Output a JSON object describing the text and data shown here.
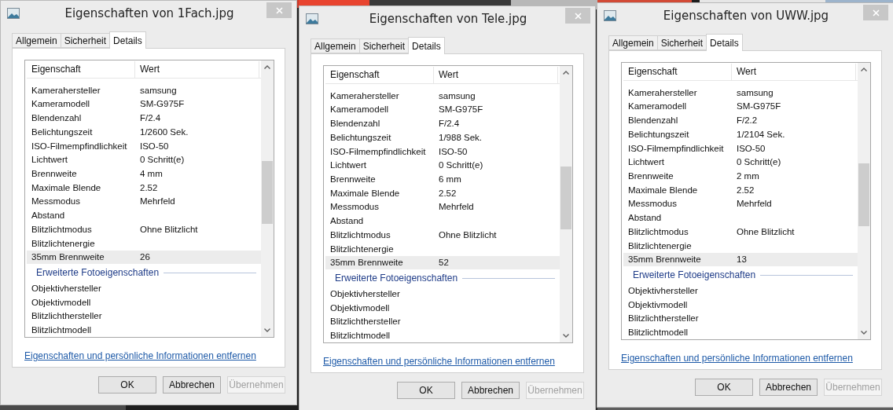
{
  "windows": [
    {
      "title": "Eigenschaften von 1Fach.jpg",
      "tabs": [
        {
          "label": "Allgemein",
          "selected": false
        },
        {
          "label": "Sicherheit",
          "selected": false
        },
        {
          "label": "Details",
          "selected": true
        }
      ],
      "columns": [
        "Eigenschaft",
        "Wert"
      ],
      "rows": [
        {
          "kind": "row",
          "property": "Kamerahersteller",
          "value": "samsung",
          "selected": false
        },
        {
          "kind": "row",
          "property": "Kameramodell",
          "value": "SM-G975F",
          "selected": false
        },
        {
          "kind": "row",
          "property": "Blendenzahl",
          "value": "F/2.4",
          "selected": false
        },
        {
          "kind": "row",
          "property": "Belichtungszeit",
          "value": "1/2600 Sek.",
          "selected": false
        },
        {
          "kind": "row",
          "property": "ISO-Filmempfindlichkeit",
          "value": "ISO-50",
          "selected": false
        },
        {
          "kind": "row",
          "property": "Lichtwert",
          "value": "0 Schritt(e)",
          "selected": false
        },
        {
          "kind": "row",
          "property": "Brennweite",
          "value": "4 mm",
          "selected": false
        },
        {
          "kind": "row",
          "property": "Maximale Blende",
          "value": "2.52",
          "selected": false
        },
        {
          "kind": "row",
          "property": "Messmodus",
          "value": "Mehrfeld",
          "selected": false
        },
        {
          "kind": "row",
          "property": "Abstand",
          "selected": false
        },
        {
          "kind": "row",
          "property": "Blitzlichtmodus",
          "value": "Ohne Blitzlicht",
          "selected": false
        },
        {
          "kind": "row",
          "property": "Blitzlichtenergie",
          "selected": false
        },
        {
          "kind": "row",
          "property": "35mm Brennweite",
          "value": "26",
          "selected": true
        },
        {
          "kind": "group",
          "label": "Erweiterte Fotoeigenschaften"
        },
        {
          "kind": "row",
          "property": "Objektivhersteller",
          "selected": false
        },
        {
          "kind": "row",
          "property": "Objektivmodell",
          "selected": false
        },
        {
          "kind": "row",
          "property": "Blitzlichthersteller",
          "selected": false
        },
        {
          "kind": "row",
          "property": "Blitzlichtmodell",
          "selected": false
        }
      ],
      "link": "Eigenschaften und persönliche Informationen entfernen",
      "buttons": [
        {
          "label": "OK",
          "disabled": false
        },
        {
          "label": "Abbrechen",
          "disabled": false
        },
        {
          "label": "Übernehmen",
          "disabled": true
        }
      ]
    },
    {
      "title": "Eigenschaften von Tele.jpg",
      "tabs": [
        {
          "label": "Allgemein",
          "selected": false
        },
        {
          "label": "Sicherheit",
          "selected": false
        },
        {
          "label": "Details",
          "selected": true
        }
      ],
      "columns": [
        "Eigenschaft",
        "Wert"
      ],
      "rows": [
        {
          "kind": "row",
          "property": "Kamerahersteller",
          "value": "samsung",
          "selected": false
        },
        {
          "kind": "row",
          "property": "Kameramodell",
          "value": "SM-G975F",
          "selected": false
        },
        {
          "kind": "row",
          "property": "Blendenzahl",
          "value": "F/2.4",
          "selected": false
        },
        {
          "kind": "row",
          "property": "Belichtungszeit",
          "value": "1/988 Sek.",
          "selected": false
        },
        {
          "kind": "row",
          "property": "ISO-Filmempfindlichkeit",
          "value": "ISO-50",
          "selected": false
        },
        {
          "kind": "row",
          "property": "Lichtwert",
          "value": "0 Schritt(e)",
          "selected": false
        },
        {
          "kind": "row",
          "property": "Brennweite",
          "value": "6 mm",
          "selected": false
        },
        {
          "kind": "row",
          "property": "Maximale Blende",
          "value": "2.52",
          "selected": false
        },
        {
          "kind": "row",
          "property": "Messmodus",
          "value": "Mehrfeld",
          "selected": false
        },
        {
          "kind": "row",
          "property": "Abstand",
          "selected": false
        },
        {
          "kind": "row",
          "property": "Blitzlichtmodus",
          "value": "Ohne Blitzlicht",
          "selected": false
        },
        {
          "kind": "row",
          "property": "Blitzlichtenergie",
          "selected": false
        },
        {
          "kind": "row",
          "property": "35mm Brennweite",
          "value": "52",
          "selected": true
        },
        {
          "kind": "group",
          "label": "Erweiterte Fotoeigenschaften"
        },
        {
          "kind": "row",
          "property": "Objektivhersteller",
          "selected": false
        },
        {
          "kind": "row",
          "property": "Objektivmodell",
          "selected": false
        },
        {
          "kind": "row",
          "property": "Blitzlichthersteller",
          "selected": false
        },
        {
          "kind": "row",
          "property": "Blitzlichtmodell",
          "selected": false
        }
      ],
      "link": "Eigenschaften und persönliche Informationen entfernen",
      "buttons": [
        {
          "label": "OK",
          "disabled": false
        },
        {
          "label": "Abbrechen",
          "disabled": false
        },
        {
          "label": "Übernehmen",
          "disabled": true
        }
      ]
    },
    {
      "title": "Eigenschaften von UWW.jpg",
      "tabs": [
        {
          "label": "Allgemein",
          "selected": false
        },
        {
          "label": "Sicherheit",
          "selected": false
        },
        {
          "label": "Details",
          "selected": true
        }
      ],
      "columns": [
        "Eigenschaft",
        "Wert"
      ],
      "rows": [
        {
          "kind": "row",
          "property": "Kamerahersteller",
          "value": "samsung",
          "selected": false
        },
        {
          "kind": "row",
          "property": "Kameramodell",
          "value": "SM-G975F",
          "selected": false
        },
        {
          "kind": "row",
          "property": "Blendenzahl",
          "value": "F/2.2",
          "selected": false
        },
        {
          "kind": "row",
          "property": "Belichtungszeit",
          "value": "1/2104 Sek.",
          "selected": false
        },
        {
          "kind": "row",
          "property": "ISO-Filmempfindlichkeit",
          "value": "ISO-50",
          "selected": false
        },
        {
          "kind": "row",
          "property": "Lichtwert",
          "value": "0 Schritt(e)",
          "selected": false
        },
        {
          "kind": "row",
          "property": "Brennweite",
          "value": "2 mm",
          "selected": false
        },
        {
          "kind": "row",
          "property": "Maximale Blende",
          "value": "2.52",
          "selected": false
        },
        {
          "kind": "row",
          "property": "Messmodus",
          "value": "Mehrfeld",
          "selected": false
        },
        {
          "kind": "row",
          "property": "Abstand",
          "selected": false
        },
        {
          "kind": "row",
          "property": "Blitzlichtmodus",
          "value": "Ohne Blitzlicht",
          "selected": false
        },
        {
          "kind": "row",
          "property": "Blitzlichtenergie",
          "selected": false
        },
        {
          "kind": "row",
          "property": "35mm Brennweite",
          "value": "13",
          "selected": true
        },
        {
          "kind": "group",
          "label": "Erweiterte Fotoeigenschaften"
        },
        {
          "kind": "row",
          "property": "Objektivhersteller",
          "selected": false
        },
        {
          "kind": "row",
          "property": "Objektivmodell",
          "selected": false
        },
        {
          "kind": "row",
          "property": "Blitzlichthersteller",
          "selected": false
        },
        {
          "kind": "row",
          "property": "Blitzlichtmodell",
          "selected": false
        }
      ],
      "link": "Eigenschaften und persönliche Informationen entfernen",
      "buttons": [
        {
          "label": "OK",
          "disabled": false
        },
        {
          "label": "Abbrechen",
          "disabled": false
        },
        {
          "label": "Übernehmen",
          "disabled": true
        }
      ]
    }
  ]
}
